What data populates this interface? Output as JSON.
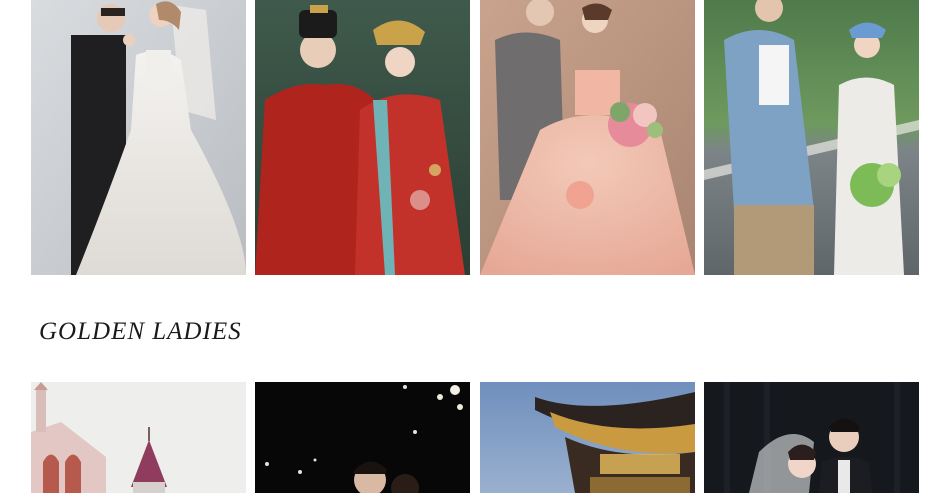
{
  "sections": [
    {
      "title": "",
      "photos": [
        {
          "id": "western-wedding-white-gown"
        },
        {
          "id": "chinese-traditional-red-robes"
        },
        {
          "id": "pink-floral-ballgown"
        },
        {
          "id": "casual-road-denim"
        }
      ]
    },
    {
      "title": "GOLDEN LADIES",
      "photos": [
        {
          "id": "castle-pink-towers"
        },
        {
          "id": "night-blossoms"
        },
        {
          "id": "golden-pavilion-dusk"
        },
        {
          "id": "studio-veil-portrait"
        }
      ]
    }
  ]
}
